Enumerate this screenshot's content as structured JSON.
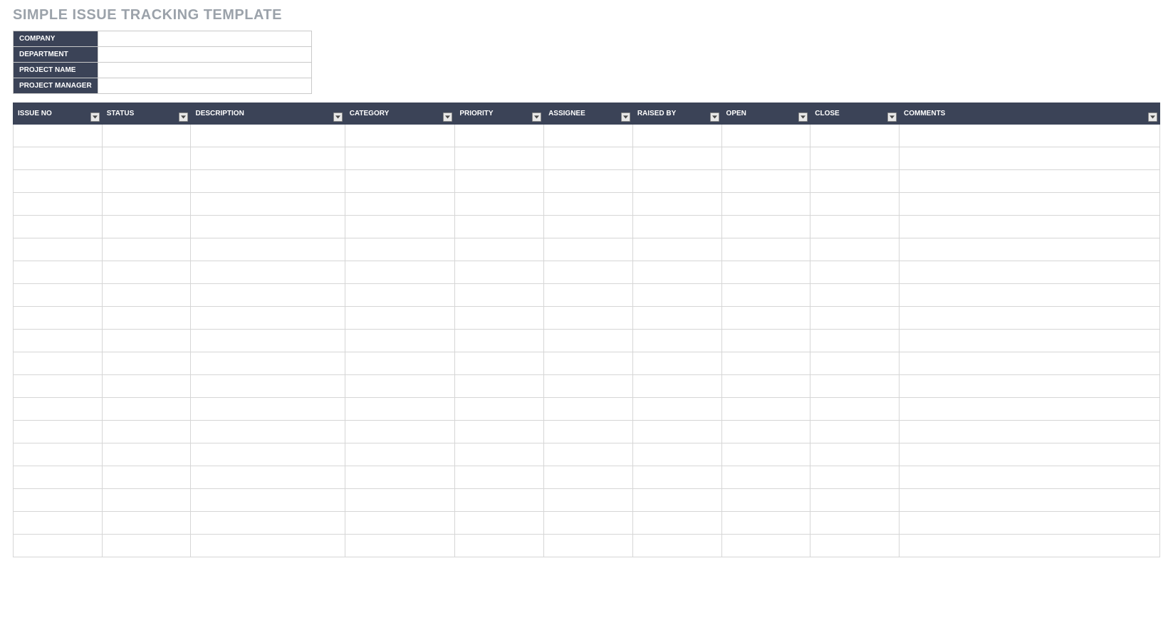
{
  "title": "SIMPLE ISSUE TRACKING TEMPLATE",
  "info": {
    "company_label": "COMPANY",
    "company_value": "",
    "department_label": "DEPARTMENT",
    "department_value": "",
    "project_name_label": "PROJECT NAME",
    "project_name_value": "",
    "project_manager_label": "PROJECT MANAGER",
    "project_manager_value": ""
  },
  "columns": [
    {
      "key": "issue_no",
      "label": "ISSUE NO"
    },
    {
      "key": "status",
      "label": "STATUS"
    },
    {
      "key": "description",
      "label": "DESCRIPTION"
    },
    {
      "key": "category",
      "label": "CATEGORY"
    },
    {
      "key": "priority",
      "label": "PRIORITY"
    },
    {
      "key": "assignee",
      "label": "ASSIGNEE"
    },
    {
      "key": "raised_by",
      "label": "RAISED BY"
    },
    {
      "key": "open",
      "label": "OPEN"
    },
    {
      "key": "close",
      "label": "CLOSE"
    },
    {
      "key": "comments",
      "label": "COMMENTS"
    }
  ],
  "rows": [
    [
      "",
      "",
      "",
      "",
      "",
      "",
      "",
      "",
      "",
      ""
    ],
    [
      "",
      "",
      "",
      "",
      "",
      "",
      "",
      "",
      "",
      ""
    ],
    [
      "",
      "",
      "",
      "",
      "",
      "",
      "",
      "",
      "",
      ""
    ],
    [
      "",
      "",
      "",
      "",
      "",
      "",
      "",
      "",
      "",
      ""
    ],
    [
      "",
      "",
      "",
      "",
      "",
      "",
      "",
      "",
      "",
      ""
    ],
    [
      "",
      "",
      "",
      "",
      "",
      "",
      "",
      "",
      "",
      ""
    ],
    [
      "",
      "",
      "",
      "",
      "",
      "",
      "",
      "",
      "",
      ""
    ],
    [
      "",
      "",
      "",
      "",
      "",
      "",
      "",
      "",
      "",
      ""
    ],
    [
      "",
      "",
      "",
      "",
      "",
      "",
      "",
      "",
      "",
      ""
    ],
    [
      "",
      "",
      "",
      "",
      "",
      "",
      "",
      "",
      "",
      ""
    ],
    [
      "",
      "",
      "",
      "",
      "",
      "",
      "",
      "",
      "",
      ""
    ],
    [
      "",
      "",
      "",
      "",
      "",
      "",
      "",
      "",
      "",
      ""
    ],
    [
      "",
      "",
      "",
      "",
      "",
      "",
      "",
      "",
      "",
      ""
    ],
    [
      "",
      "",
      "",
      "",
      "",
      "",
      "",
      "",
      "",
      ""
    ],
    [
      "",
      "",
      "",
      "",
      "",
      "",
      "",
      "",
      "",
      ""
    ],
    [
      "",
      "",
      "",
      "",
      "",
      "",
      "",
      "",
      "",
      ""
    ],
    [
      "",
      "",
      "",
      "",
      "",
      "",
      "",
      "",
      "",
      ""
    ],
    [
      "",
      "",
      "",
      "",
      "",
      "",
      "",
      "",
      "",
      ""
    ],
    [
      "",
      "",
      "",
      "",
      "",
      "",
      "",
      "",
      "",
      ""
    ]
  ]
}
